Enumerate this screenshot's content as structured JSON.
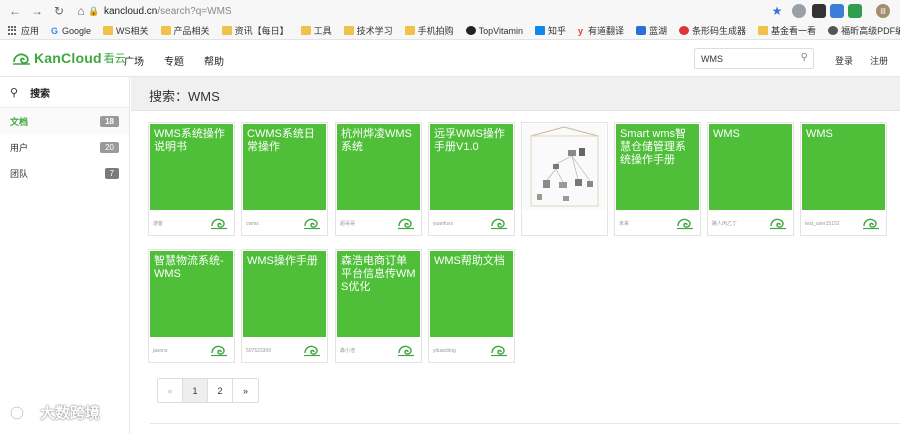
{
  "browser": {
    "url_host": "kancloud.cn",
    "url_path": "/search?q=WMS",
    "avatar_letter": "ill",
    "bookmarks": [
      {
        "icon": "apps-icon",
        "label": "应用"
      },
      {
        "icon": "google-icon",
        "label": "Google"
      },
      {
        "icon": "folder-icon",
        "label": "WS相关"
      },
      {
        "icon": "folder-icon",
        "label": "产品相关"
      },
      {
        "icon": "folder-icon",
        "label": "资讯【每日】"
      },
      {
        "icon": "folder-icon",
        "label": "工具"
      },
      {
        "icon": "folder-icon",
        "label": "技术学习"
      },
      {
        "icon": "folder-icon",
        "label": "手机拍购"
      },
      {
        "icon": "github-icon",
        "label": "TopVitamin"
      },
      {
        "icon": "zhihu-icon",
        "label": "知乎"
      },
      {
        "icon": "youdao-icon",
        "label": "有道翻译"
      },
      {
        "icon": "lanhu-icon",
        "label": "蓝湖"
      },
      {
        "icon": "barcode-icon",
        "label": "条形码生成器"
      },
      {
        "icon": "folder-icon",
        "label": "基金看一看"
      },
      {
        "icon": "pdf-icon",
        "label": "福昕高级PDF编辑..."
      }
    ]
  },
  "site": {
    "logo_text": "KanCloud",
    "logo_cn": "看云",
    "nav": [
      "广场",
      "专题",
      "帮助"
    ],
    "search_value": "WMS",
    "login": "登录",
    "register": "注册"
  },
  "sidebar": {
    "search_label": "搜索",
    "items": [
      {
        "label": "文档",
        "count": "18",
        "active": true
      },
      {
        "label": "用户",
        "count": "20",
        "active": false
      },
      {
        "label": "团队",
        "count": "7",
        "active": false
      }
    ]
  },
  "main": {
    "title": "搜索：WMS",
    "cards": [
      {
        "title": "WMS系统操作说明书",
        "author": "游客",
        "image": false
      },
      {
        "title": "CWMS系统日常操作",
        "author": "cwms",
        "image": false
      },
      {
        "title": "杭州烨凌WMS系统",
        "author": "超哥哥",
        "image": false
      },
      {
        "title": "远孚WMS操作手册V1.0",
        "author": "yuanfuxx",
        "image": false
      },
      {
        "title": "",
        "author": "",
        "image": true
      },
      {
        "title": "Smart wms智慧仓储管理系统操作手册",
        "author": "未来",
        "image": false
      },
      {
        "title": "WMS",
        "author": "路人丙乙丁",
        "image": false
      },
      {
        "title": "WMS",
        "author": "test_user15152",
        "image": false
      },
      {
        "title": "智慧物流系统-WMS",
        "author": "jasons",
        "image": false
      },
      {
        "title": "WMS操作手册",
        "author": "507523309",
        "image": false
      },
      {
        "title": "森浩电商订单平台信息传WMS优化",
        "author": "森小浩",
        "image": false
      },
      {
        "title": "WMS帮助文档",
        "author": "yituanblog",
        "image": false
      }
    ],
    "pager": [
      "«",
      "1",
      "2",
      "»"
    ]
  },
  "watermark": "大数跨境",
  "colors": {
    "brand": "#3fa73f",
    "cover": "#4fbf3a"
  }
}
